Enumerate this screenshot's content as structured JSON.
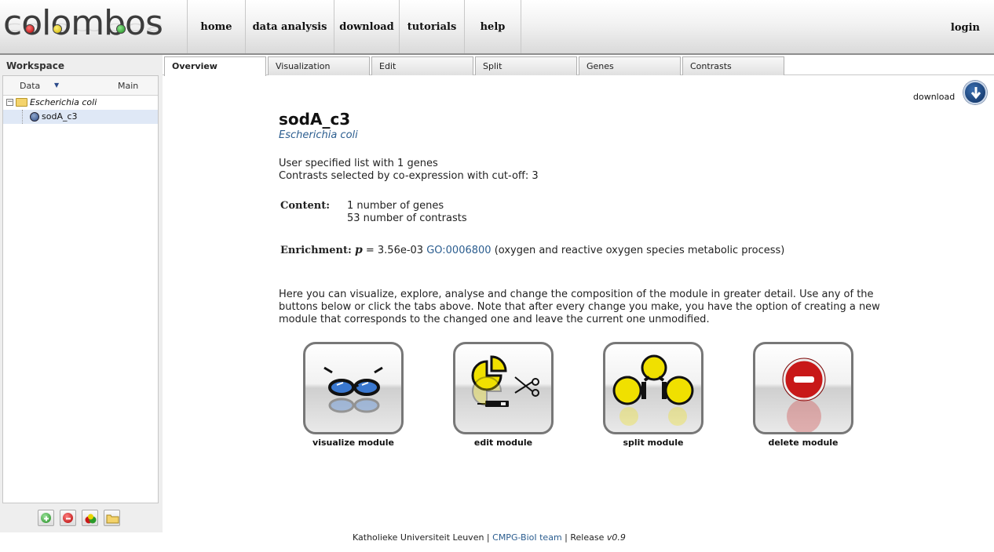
{
  "header": {
    "logo_text": "colombos",
    "nav": [
      "home",
      "data analysis",
      "download",
      "tutorials",
      "help"
    ],
    "login": "login"
  },
  "workspace": {
    "title": "Workspace",
    "columns": {
      "data": "Data",
      "main": "Main"
    },
    "tree": {
      "organism": "Escherichia coli",
      "module": "sodA_c3"
    },
    "tools": [
      "add-icon",
      "remove-icon",
      "merge-icon",
      "folder-icon"
    ]
  },
  "tabs": [
    "Overview",
    "Visualization",
    "Edit",
    "Split",
    "Genes",
    "Contrasts"
  ],
  "active_tab": "Overview",
  "main": {
    "download_label": "download",
    "module_title": "sodA_c3",
    "organism": "Escherichia coli",
    "line1": "User specified list with 1 genes",
    "line2": "Contrasts selected by co-expression with cut-off: 3",
    "content_label": "Content:",
    "content_genes": "1 number of genes",
    "content_contrasts": "53 number of contrasts",
    "enrichment_label": "Enrichment:",
    "enrichment_p_symbol": "p",
    "enrichment_value": " = 3.56e-03 ",
    "enrichment_go": "GO:0006800",
    "enrichment_desc": " (oxygen and reactive oxygen species metabolic process)",
    "intro": "Here you can visualize, explore, analyse and change the composition of the module in greater detail. Use any of the buttons below or click the tabs above. Note that after every change you make, you have the option of creating a new module that corresponds to the changed one and leave the current one unmodified.",
    "actions": [
      "visualize module",
      "edit module",
      "split module",
      "delete module"
    ]
  },
  "footer": {
    "org": "Katholieke Universiteit Leuven | ",
    "team": "CMPG-BioI team",
    "release_prefix": " | Release ",
    "release": "v0.9"
  },
  "colors": {
    "link": "#2b5d8f",
    "selection": "#dfe8f6",
    "delete_red": "#c81818",
    "module_yellow": "#f0e000"
  }
}
